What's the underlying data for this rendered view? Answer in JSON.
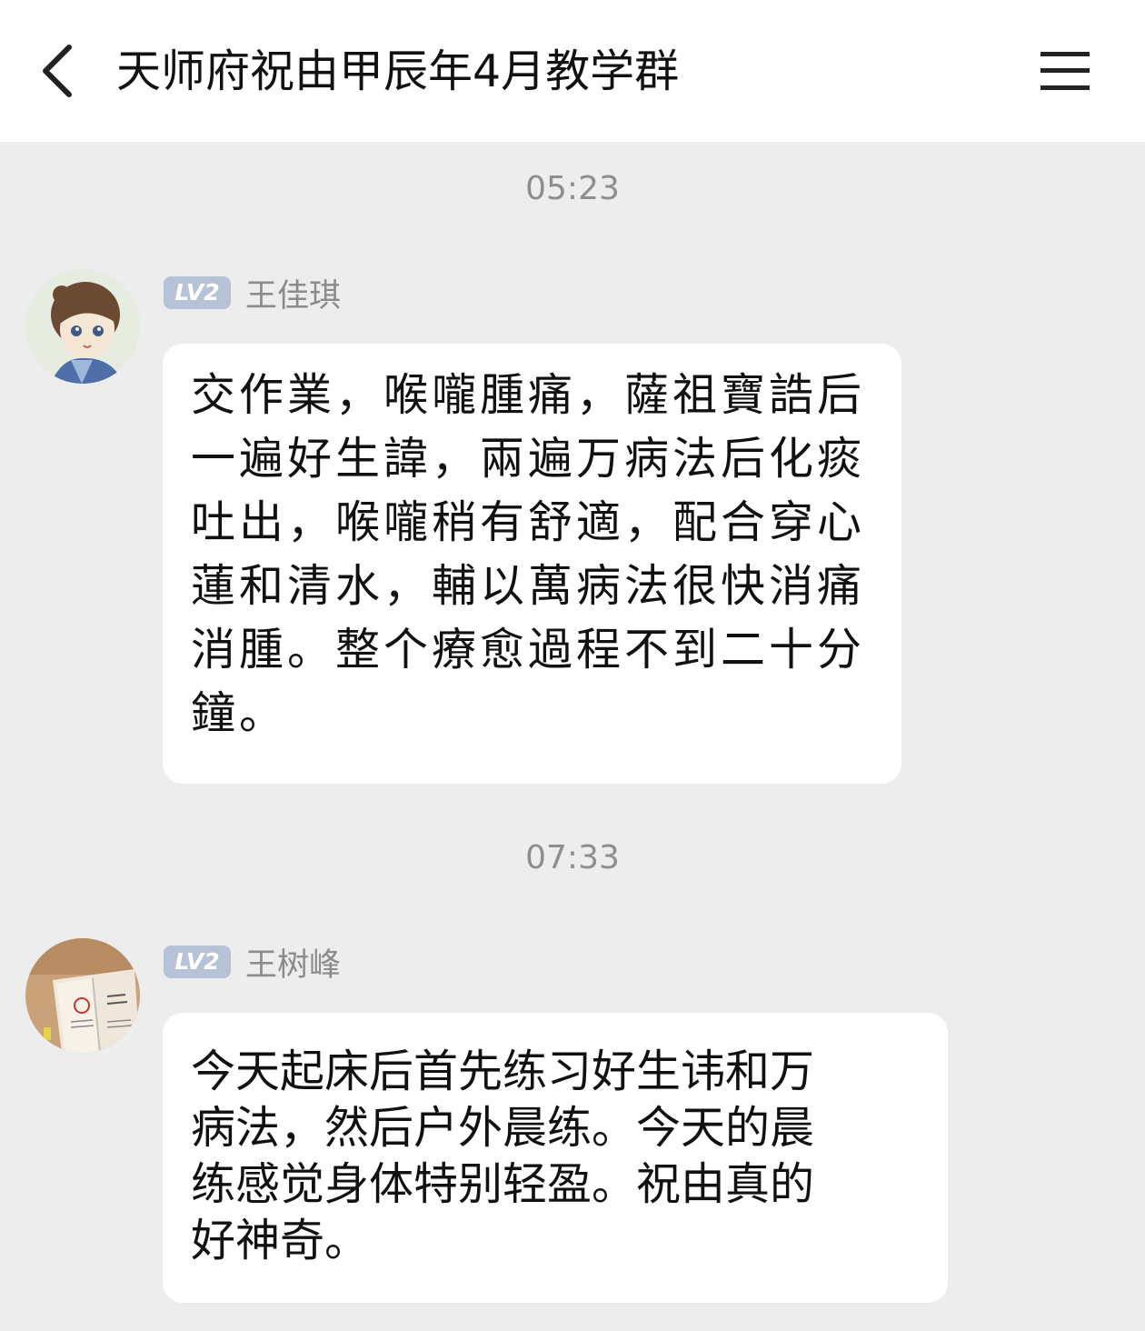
{
  "header": {
    "title": "天师府祝由甲辰年4月教学群",
    "back_icon": "chevron-left-icon",
    "menu_icon": "hamburger-menu-icon"
  },
  "messages": [
    {
      "timestamp": "05:23",
      "level": "LV2",
      "sender": "王佳琪",
      "lines": [
        "交作業，喉嚨腫痛，薩祖寶誥后",
        "一遍好生諱，兩遍万病法后化痰",
        "吐出，喉嚨稍有舒適，配合穿心",
        "蓮和清水，輔以萬病法很快消痛",
        "消腫。整个療愈過程不到二十分",
        "鐘。"
      ]
    },
    {
      "timestamp": "07:33",
      "level": "LV2",
      "sender": "王树峰",
      "lines": [
        "今天起床后首先练习好生讳和万",
        "病法，然后户外晨练。今天的晨",
        "练感觉身体特别轻盈。祝由真的",
        "好神奇。"
      ]
    }
  ],
  "colors": {
    "background": "#ededed",
    "bubble": "#ffffff",
    "level_badge": "#b8c2d6"
  }
}
